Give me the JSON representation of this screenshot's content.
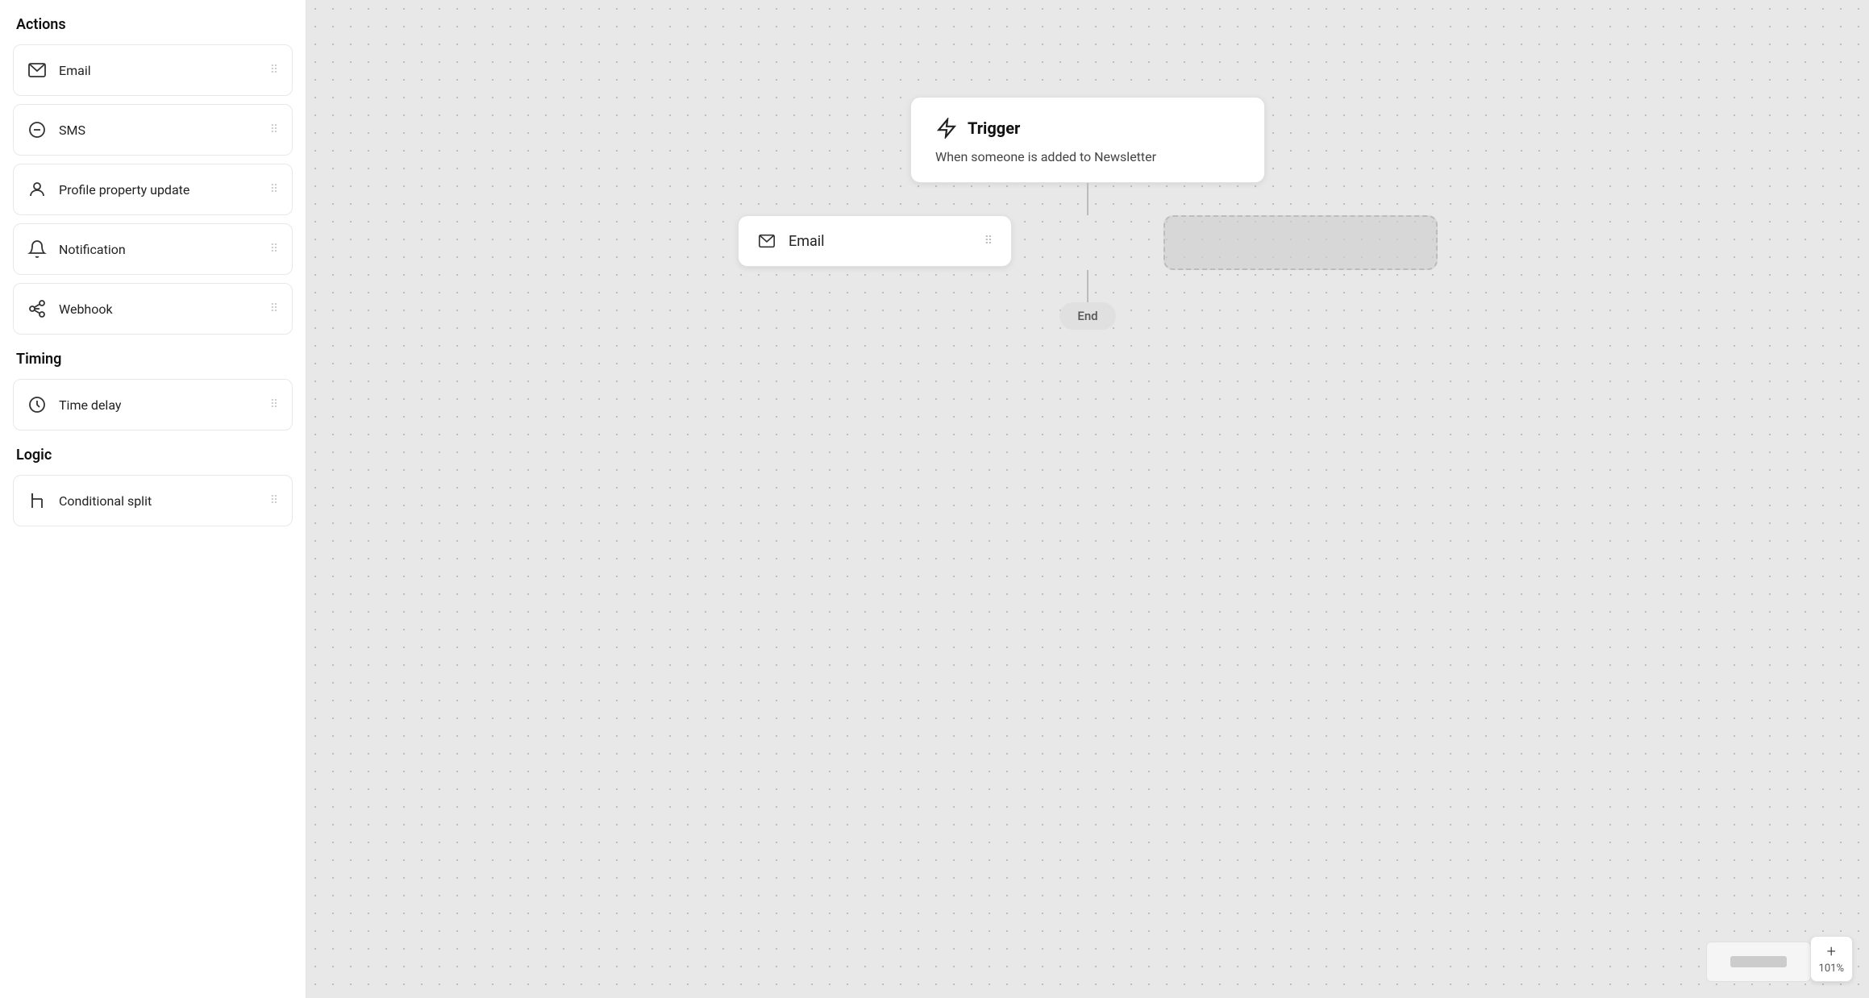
{
  "sidebar": {
    "sections": [
      {
        "id": "actions",
        "title": "Actions",
        "items": [
          {
            "id": "email",
            "label": "Email",
            "icon": "email-icon"
          },
          {
            "id": "sms",
            "label": "SMS",
            "icon": "sms-icon"
          },
          {
            "id": "profile-property-update",
            "label": "Profile property update",
            "icon": "profile-icon"
          },
          {
            "id": "notification",
            "label": "Notification",
            "icon": "notification-icon"
          },
          {
            "id": "webhook",
            "label": "Webhook",
            "icon": "webhook-icon"
          }
        ]
      },
      {
        "id": "timing",
        "title": "Timing",
        "items": [
          {
            "id": "time-delay",
            "label": "Time delay",
            "icon": "clock-icon"
          }
        ]
      },
      {
        "id": "logic",
        "title": "Logic",
        "items": [
          {
            "id": "conditional-split",
            "label": "Conditional split",
            "icon": "split-icon"
          }
        ]
      }
    ]
  },
  "canvas": {
    "trigger_node": {
      "title": "Trigger",
      "description": "When someone is added to Newsletter"
    },
    "email_node": {
      "label": "Email"
    },
    "end_node": {
      "label": "End"
    },
    "zoom_level": "101%",
    "zoom_plus_label": "+"
  }
}
